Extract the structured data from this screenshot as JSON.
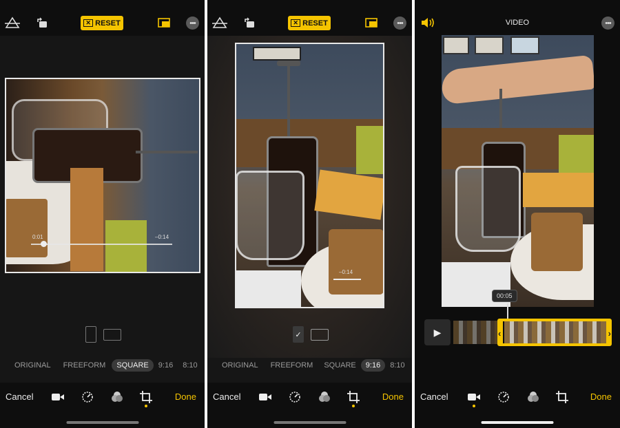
{
  "panels": [
    {
      "top": {
        "reset_label": "RESET"
      },
      "scrub": {
        "left": "0:01",
        "right": "–0:14"
      },
      "ratios": [
        {
          "label": "ORIGINAL",
          "active": false
        },
        {
          "label": "FREEFORM",
          "active": false
        },
        {
          "label": "SQUARE",
          "active": true
        },
        {
          "label": "9:16",
          "active": false
        },
        {
          "label": "8:10",
          "active": false
        }
      ],
      "bottom": {
        "cancel": "Cancel",
        "done": "Done"
      }
    },
    {
      "top": {
        "reset_label": "RESET"
      },
      "scrub": {
        "right": "–0:14"
      },
      "ratios": [
        {
          "label": "ORIGINAL",
          "active": false
        },
        {
          "label": "FREEFORM",
          "active": false
        },
        {
          "label": "SQUARE",
          "active": false
        },
        {
          "label": "9:16",
          "active": true
        },
        {
          "label": "8:10",
          "active": false
        }
      ],
      "bottom": {
        "cancel": "Cancel",
        "done": "Done"
      }
    },
    {
      "top": {
        "title": "VIDEO"
      },
      "time_label": "00:05",
      "bottom": {
        "cancel": "Cancel",
        "done": "Done"
      }
    }
  ],
  "colors": {
    "accent": "#f5c400",
    "background": "#161616"
  },
  "icons": [
    "straighten-icon",
    "rotate-icon",
    "reset-icon",
    "aspect-ratio-icon",
    "more-icon",
    "speaker-icon",
    "video-camera-icon",
    "adjust-dial-icon",
    "filters-icon",
    "crop-icon",
    "play-icon"
  ]
}
